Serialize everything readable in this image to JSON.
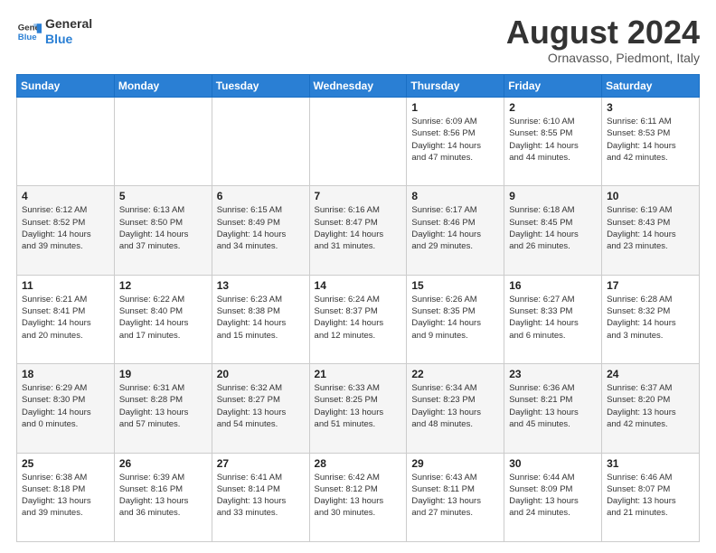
{
  "logo": {
    "line1": "General",
    "line2": "Blue"
  },
  "title": "August 2024",
  "location": "Ornavasso, Piedmont, Italy",
  "days_of_week": [
    "Sunday",
    "Monday",
    "Tuesday",
    "Wednesday",
    "Thursday",
    "Friday",
    "Saturday"
  ],
  "weeks": [
    [
      {
        "day": "",
        "info": ""
      },
      {
        "day": "",
        "info": ""
      },
      {
        "day": "",
        "info": ""
      },
      {
        "day": "",
        "info": ""
      },
      {
        "day": "1",
        "info": "Sunrise: 6:09 AM\nSunset: 8:56 PM\nDaylight: 14 hours\nand 47 minutes."
      },
      {
        "day": "2",
        "info": "Sunrise: 6:10 AM\nSunset: 8:55 PM\nDaylight: 14 hours\nand 44 minutes."
      },
      {
        "day": "3",
        "info": "Sunrise: 6:11 AM\nSunset: 8:53 PM\nDaylight: 14 hours\nand 42 minutes."
      }
    ],
    [
      {
        "day": "4",
        "info": "Sunrise: 6:12 AM\nSunset: 8:52 PM\nDaylight: 14 hours\nand 39 minutes."
      },
      {
        "day": "5",
        "info": "Sunrise: 6:13 AM\nSunset: 8:50 PM\nDaylight: 14 hours\nand 37 minutes."
      },
      {
        "day": "6",
        "info": "Sunrise: 6:15 AM\nSunset: 8:49 PM\nDaylight: 14 hours\nand 34 minutes."
      },
      {
        "day": "7",
        "info": "Sunrise: 6:16 AM\nSunset: 8:47 PM\nDaylight: 14 hours\nand 31 minutes."
      },
      {
        "day": "8",
        "info": "Sunrise: 6:17 AM\nSunset: 8:46 PM\nDaylight: 14 hours\nand 29 minutes."
      },
      {
        "day": "9",
        "info": "Sunrise: 6:18 AM\nSunset: 8:45 PM\nDaylight: 14 hours\nand 26 minutes."
      },
      {
        "day": "10",
        "info": "Sunrise: 6:19 AM\nSunset: 8:43 PM\nDaylight: 14 hours\nand 23 minutes."
      }
    ],
    [
      {
        "day": "11",
        "info": "Sunrise: 6:21 AM\nSunset: 8:41 PM\nDaylight: 14 hours\nand 20 minutes."
      },
      {
        "day": "12",
        "info": "Sunrise: 6:22 AM\nSunset: 8:40 PM\nDaylight: 14 hours\nand 17 minutes."
      },
      {
        "day": "13",
        "info": "Sunrise: 6:23 AM\nSunset: 8:38 PM\nDaylight: 14 hours\nand 15 minutes."
      },
      {
        "day": "14",
        "info": "Sunrise: 6:24 AM\nSunset: 8:37 PM\nDaylight: 14 hours\nand 12 minutes."
      },
      {
        "day": "15",
        "info": "Sunrise: 6:26 AM\nSunset: 8:35 PM\nDaylight: 14 hours\nand 9 minutes."
      },
      {
        "day": "16",
        "info": "Sunrise: 6:27 AM\nSunset: 8:33 PM\nDaylight: 14 hours\nand 6 minutes."
      },
      {
        "day": "17",
        "info": "Sunrise: 6:28 AM\nSunset: 8:32 PM\nDaylight: 14 hours\nand 3 minutes."
      }
    ],
    [
      {
        "day": "18",
        "info": "Sunrise: 6:29 AM\nSunset: 8:30 PM\nDaylight: 14 hours\nand 0 minutes."
      },
      {
        "day": "19",
        "info": "Sunrise: 6:31 AM\nSunset: 8:28 PM\nDaylight: 13 hours\nand 57 minutes."
      },
      {
        "day": "20",
        "info": "Sunrise: 6:32 AM\nSunset: 8:27 PM\nDaylight: 13 hours\nand 54 minutes."
      },
      {
        "day": "21",
        "info": "Sunrise: 6:33 AM\nSunset: 8:25 PM\nDaylight: 13 hours\nand 51 minutes."
      },
      {
        "day": "22",
        "info": "Sunrise: 6:34 AM\nSunset: 8:23 PM\nDaylight: 13 hours\nand 48 minutes."
      },
      {
        "day": "23",
        "info": "Sunrise: 6:36 AM\nSunset: 8:21 PM\nDaylight: 13 hours\nand 45 minutes."
      },
      {
        "day": "24",
        "info": "Sunrise: 6:37 AM\nSunset: 8:20 PM\nDaylight: 13 hours\nand 42 minutes."
      }
    ],
    [
      {
        "day": "25",
        "info": "Sunrise: 6:38 AM\nSunset: 8:18 PM\nDaylight: 13 hours\nand 39 minutes."
      },
      {
        "day": "26",
        "info": "Sunrise: 6:39 AM\nSunset: 8:16 PM\nDaylight: 13 hours\nand 36 minutes."
      },
      {
        "day": "27",
        "info": "Sunrise: 6:41 AM\nSunset: 8:14 PM\nDaylight: 13 hours\nand 33 minutes."
      },
      {
        "day": "28",
        "info": "Sunrise: 6:42 AM\nSunset: 8:12 PM\nDaylight: 13 hours\nand 30 minutes."
      },
      {
        "day": "29",
        "info": "Sunrise: 6:43 AM\nSunset: 8:11 PM\nDaylight: 13 hours\nand 27 minutes."
      },
      {
        "day": "30",
        "info": "Sunrise: 6:44 AM\nSunset: 8:09 PM\nDaylight: 13 hours\nand 24 minutes."
      },
      {
        "day": "31",
        "info": "Sunrise: 6:46 AM\nSunset: 8:07 PM\nDaylight: 13 hours\nand 21 minutes."
      }
    ]
  ]
}
